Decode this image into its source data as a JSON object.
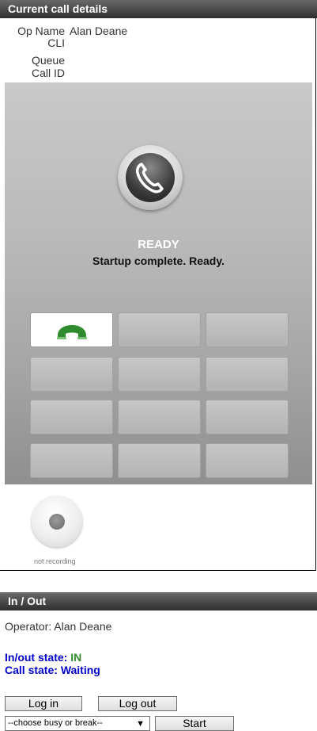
{
  "call_details": {
    "title": "Current call details",
    "fields": [
      {
        "label": "Op Name",
        "value": "Alan Deane"
      },
      {
        "label": "CLI",
        "value": ""
      },
      {
        "label": "Queue",
        "value": ""
      },
      {
        "label": "Call ID",
        "value": ""
      }
    ]
  },
  "phone": {
    "state": "READY",
    "message": "Startup complete. Ready.",
    "keypad_rows": 4,
    "keypad_cols": 3,
    "active_key_icon": "phone-handset-icon",
    "colors": {
      "handset_green": "#2e8b2e"
    }
  },
  "recording": {
    "label": "not recording",
    "icon": "record-icon"
  },
  "inout": {
    "title": "In / Out",
    "operator": "Operator: Alan Deane",
    "inout_state_label": "In/out state:",
    "inout_state_value": "IN",
    "call_state_label": "Call state:",
    "call_state_value": "Waiting",
    "login_label": "Log in",
    "logout_label": "Log out",
    "break_select": "--choose busy or break--",
    "start_label": "Start",
    "colors": {
      "label_blue": "#0000cc",
      "in_green": "#2e8b2e"
    }
  }
}
